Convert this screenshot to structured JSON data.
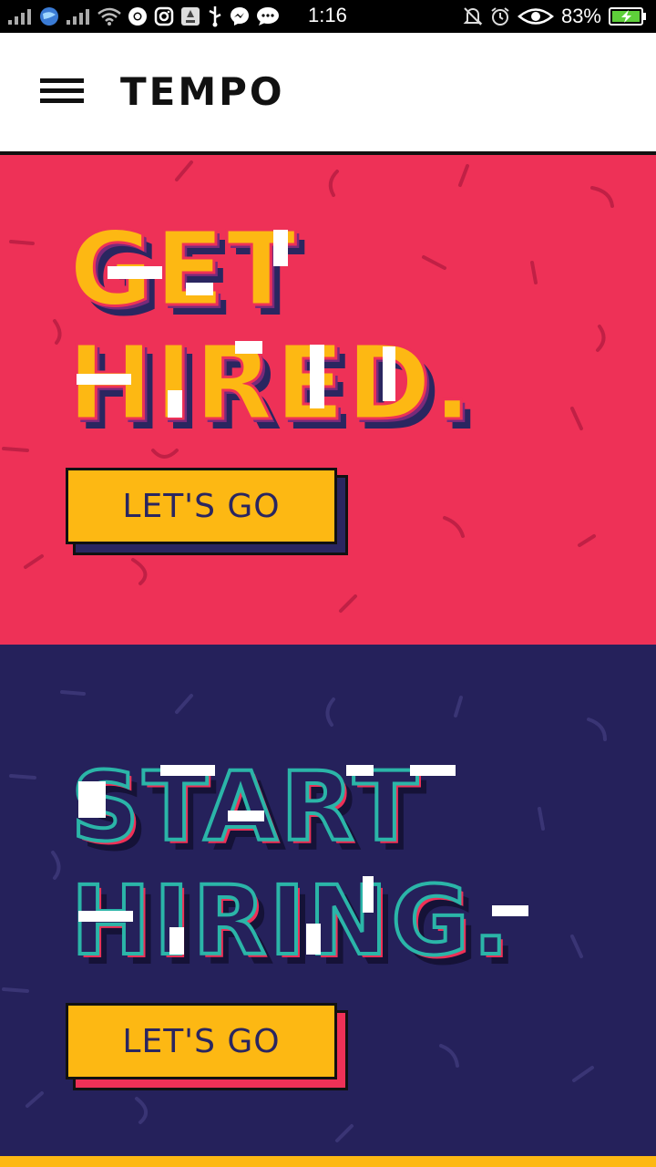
{
  "status_bar": {
    "time": "1:16",
    "battery_percent": "83%",
    "icons_left": [
      "signal-icon",
      "globe-icon",
      "signal-icon",
      "wifi-icon",
      "chrome-icon",
      "instagram-icon",
      "app-icon",
      "usb-icon",
      "messenger-icon",
      "chat-icon"
    ],
    "icons_right": [
      "mute-icon",
      "alarm-icon",
      "eye-icon",
      "battery-icon"
    ]
  },
  "header": {
    "logo": "TEMPO"
  },
  "hero_candidate": {
    "headline_line1": "GET",
    "headline_line2": "HIRED.",
    "cta_label": "LET'S GO",
    "background": "#ee3157"
  },
  "hero_employer": {
    "headline_line1": "START",
    "headline_line2": "HIRING.",
    "cta_label": "LET'S GO",
    "background": "#25215b"
  },
  "colors": {
    "accent_yellow": "#fdb813",
    "pink": "#ee3157",
    "navy": "#25215b",
    "teal": "#2bb5a8"
  }
}
